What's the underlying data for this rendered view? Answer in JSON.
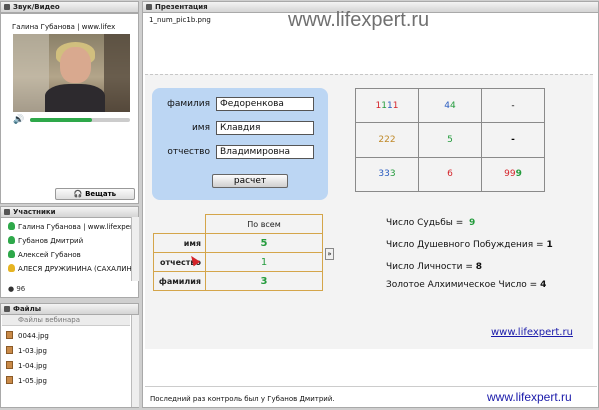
{
  "left": {
    "video_panel": {
      "title": "Звук/Видео",
      "user": "Галина Губанова | www.lifex",
      "volume": 0.62,
      "speak_button": "Вещать"
    },
    "participants_panel": {
      "title": "Участники",
      "items": [
        {
          "name": "Галина Губанова | www.lifexpert",
          "color": "#2ea84a"
        },
        {
          "name": "Губанов Дмитрий",
          "color": "#2ea84a"
        },
        {
          "name": "Алексей Губанов",
          "color": "#2ea84a"
        },
        {
          "name": "АЛЕСЯ ДРУЖИНИНА (САХАЛИН",
          "color": "#e6b422"
        }
      ],
      "count": "96"
    },
    "files_panel": {
      "title": "Файлы",
      "header": "Файлы вебинара",
      "items": [
        "0044.jpg",
        "1-03.jpg",
        "1-04.jpg",
        "1-05.jpg"
      ]
    }
  },
  "presentation": {
    "title": "Презентация",
    "filename": "1_num_pic1b.png",
    "watermark": "www.lifexpert.ru",
    "form": {
      "surname_label": "фамилия",
      "surname": "Федоренкова",
      "name_label": "имя",
      "name": "Клавдия",
      "patronymic_label": "отчество",
      "patronymic": "Владимировна",
      "calc_button": "расчет"
    },
    "grid": [
      [
        {
          "text": "1111",
          "color": "multi"
        },
        {
          "text": "44",
          "color": "multi"
        },
        {
          "text": "-",
          "color": "#111"
        }
      ],
      [
        {
          "text": "222",
          "color": "#c08a2a"
        },
        {
          "text": "5",
          "color": "#239b3c"
        },
        {
          "text": "-",
          "color": "#111"
        }
      ],
      [
        {
          "text": "333",
          "color": "multi"
        },
        {
          "text": "6",
          "color": "#d4242a"
        },
        {
          "text": "999",
          "color": "multi"
        }
      ]
    ],
    "stats_table": {
      "column_header": "По всем",
      "rows": [
        {
          "label": "имя",
          "value": "5"
        },
        {
          "label": "отчество",
          "value": "1"
        },
        {
          "label": "фамилия",
          "value": "3"
        }
      ]
    },
    "results": [
      {
        "label": "Число Судьбы =",
        "value": "9"
      },
      {
        "label": "Число Душевного Побуждения =",
        "value": "1"
      },
      {
        "label": "Число Личности =",
        "value": "8"
      },
      {
        "label": "Золотое Алхимическое Число =",
        "value": "4"
      }
    ],
    "slide_link": "www.lifexpert.ru"
  },
  "footer": {
    "status": "Последний раз контроль был у Губанов Дмитрий.",
    "link": "www.lifexpert.ru"
  }
}
